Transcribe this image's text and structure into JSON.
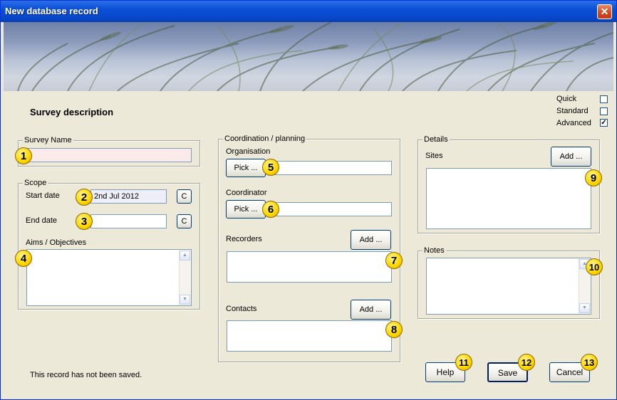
{
  "window": {
    "title": "New database record",
    "close_glyph": "✕"
  },
  "header": {
    "heading": "Survey description"
  },
  "mode": {
    "quick_label": "Quick",
    "quick_checked": false,
    "standard_label": "Standard",
    "standard_checked": false,
    "advanced_label": "Advanced",
    "advanced_checked": true,
    "check_glyph": "✓"
  },
  "survey_name": {
    "group_label": "Survey Name",
    "value": ""
  },
  "scope": {
    "group_label": "Scope",
    "start_label": "Start date",
    "start_value": "2nd Jul 2012",
    "end_label": "End date",
    "end_value": "",
    "calendar_button": "C",
    "aims_label": "Aims / Objectives",
    "aims_value": ""
  },
  "coordination": {
    "group_label": "Coordination / planning",
    "organisation_label": "Organisation",
    "coordinator_label": "Coordinator",
    "pick_button": "Pick ...",
    "recorders_label": "Recorders",
    "contacts_label": "Contacts",
    "add_button": "Add ..."
  },
  "details": {
    "group_label": "Details",
    "sites_label": "Sites",
    "add_button": "Add ..."
  },
  "notes": {
    "group_label": "Notes"
  },
  "footer": {
    "status": "This record has not been saved.",
    "help": "Help",
    "save": "Save",
    "cancel": "Cancel"
  },
  "callouts": [
    "1",
    "2",
    "3",
    "4",
    "5",
    "6",
    "7",
    "8",
    "9",
    "10",
    "11",
    "12",
    "13"
  ],
  "colors": {
    "title_bar": "#0a4fd6",
    "window_bg": "#ece9d8",
    "required_field": "#fbeaea",
    "date_field": "#eeeef9",
    "callout": "#ffd800"
  }
}
